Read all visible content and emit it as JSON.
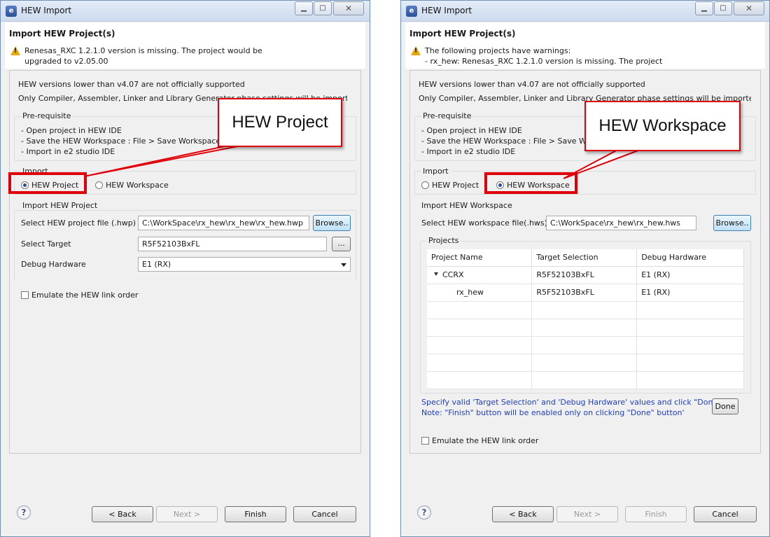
{
  "dialog1": {
    "title": "HEW Import",
    "header_title": "Import HEW Project(s)",
    "warning_line1": "Renesas_RXC 1.2.1.0 version is missing. The project would be",
    "warning_line2": "upgraded to  v2.05.00",
    "note1": "HEW versions lower than v4.07 are not officially supported",
    "note2": "Only Compiler, Assembler, Linker and Library Generator phase settings will be imported",
    "prereq_label": "Pre-requisite",
    "prereq_items": [
      "- Open project in HEW IDE",
      "- Save the HEW Workspace : File > Save Workspace",
      "- Import in e2 studio IDE"
    ],
    "import_label": "Import",
    "radio_project": "HEW Project",
    "radio_workspace": "HEW Workspace",
    "selected": "HEW Project",
    "section_label": "Import HEW Project",
    "select_file_label": "Select HEW project file (.hwp) :",
    "file_value": "C:\\WorkSpace\\rx_hew\\rx_hew\\rx_hew.hwp",
    "browse_label": "Browse..",
    "select_target_label": "Select Target",
    "target_value": "R5F52103BxFL",
    "ellipsis_label": "...",
    "debug_label": "Debug Hardware",
    "debug_value": "E1 (RX)",
    "emulate_label": "Emulate the HEW link order",
    "callout": "HEW Project",
    "buttons": {
      "help": "?",
      "back": "< Back",
      "next": "Next >",
      "finish": "Finish",
      "cancel": "Cancel"
    }
  },
  "dialog2": {
    "title": "HEW Import",
    "header_title": "Import HEW Project(s)",
    "warning_line1": "The following projects have warnings:",
    "warning_line2": "- rx_hew: Renesas_RXC 1.2.1.0 version is missing. The project",
    "note1": "HEW versions lower than v4.07 are not officially supported",
    "note2": "Only Compiler, Assembler, Linker and Library Generator phase settings will be imported",
    "prereq_label": "Pre-requisite",
    "prereq_items": [
      "- Open project in HEW IDE",
      "- Save the HEW Workspace : File > Save Workspace",
      "- Import in e2 studio IDE"
    ],
    "import_label": "Import",
    "radio_project": "HEW Project",
    "radio_workspace": "HEW Workspace",
    "selected": "HEW Workspace",
    "section_label": "Import HEW Workspace",
    "select_file_label": "Select HEW workspace file(.hws):",
    "file_value": "C:\\WorkSpace\\rx_hew\\rx_hew.hws",
    "browse_label": "Browse..",
    "projects_label": "Projects",
    "columns": [
      "Project Name",
      "Target Selection",
      "Debug Hardware"
    ],
    "rows": [
      {
        "name": "CCRX",
        "target": "R5F52103BxFL",
        "debug": "E1 (RX)"
      },
      {
        "name": "rx_hew",
        "target": "R5F52103BxFL",
        "debug": "E1 (RX)"
      }
    ],
    "info_line1": "Specify valid 'Target Selection' and 'Debug Hardware' values and click \"Done\".",
    "info_line2": "Note: \"Finish\" button will be enabled only on clicking \"Done\" button'",
    "done_label": "Done",
    "emulate_label": "Emulate the HEW link order",
    "callout": "HEW Workspace",
    "buttons": {
      "help": "?",
      "back": "< Back",
      "next": "Next >",
      "finish": "Finish",
      "cancel": "Cancel"
    }
  },
  "colors": {
    "callout_border": "#e0000a",
    "info_text": "#1f3fbf",
    "titlebar": "#cddbee"
  }
}
